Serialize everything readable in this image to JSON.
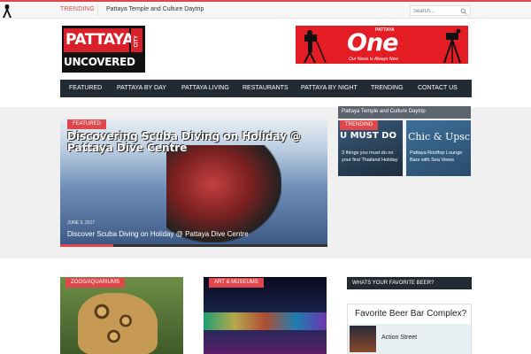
{
  "topbar": {
    "trending_label": "TRENDING",
    "trending_text": "Pattaya Temple and Culture Daytrip",
    "search_placeholder": "Search..."
  },
  "logo": {
    "line1": "PATTAYA",
    "line2": "CITY",
    "line3": "UNCOVERED"
  },
  "banner": {
    "small": "PATTAYA",
    "title": "One",
    "tagline": "Our News Is Always New"
  },
  "nav": {
    "items": [
      "FEATURED",
      "PATTAYA BY DAY",
      "PATTAYA LIVING",
      "RESTAURANTS",
      "PATTAYA BY NIGHT",
      "TRENDING",
      "CONTACT US"
    ]
  },
  "hero": {
    "badge": "FEATURED",
    "image_headline": "Discovering Scuba Diving on Holiday @ Pattaya Dive Centre",
    "date": "JUNE 3, 2017",
    "title": "Discover Scuba Diving on Holiday @ Pattaya Dive Centre"
  },
  "side": {
    "top_title": "Pattaya Temple and Culture Daytrip",
    "badge": "TRENDING",
    "tiles": [
      {
        "image_text": "U MUST DO",
        "caption": "3 things you must do on your first Thailand Holiday"
      },
      {
        "image_text": "Chic & Upsc",
        "caption": "Pattaya Rooftop Lounge Bars with Sea Views"
      }
    ]
  },
  "cards": [
    {
      "badge": "ZOOS/AQUARIUMS"
    },
    {
      "badge": "ART & MUSEUMS"
    }
  ],
  "widget": {
    "title": "WHATS YOUR FAVORITE BEER?",
    "poll_question": "Favorite Beer Bar Complex?",
    "option1": "Action Street"
  },
  "colors": {
    "accent": "#e0474c",
    "nav_bg": "#222b33",
    "banner_red": "#e41c23"
  }
}
